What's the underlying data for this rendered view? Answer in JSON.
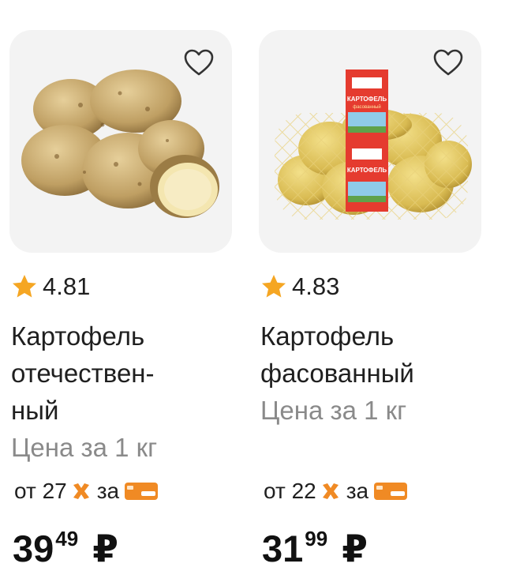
{
  "products": [
    {
      "rating": "4.81",
      "title": "Картофель\nотечествен-\nный",
      "unit_text": "Цена за 1 кг",
      "promo": {
        "from": "от",
        "threshold": "27",
        "za": "за"
      },
      "price": {
        "rub": "39",
        "kop": "49",
        "currency": "₽"
      },
      "icons": {
        "favorite": "heart-outline-icon",
        "rating": "star-icon",
        "promo": "x-mark-icon",
        "payment": "mir-card-icon"
      }
    },
    {
      "rating": "4.83",
      "title": "Картофель\nфасованный",
      "unit_text": "Цена за 1 кг",
      "promo": {
        "from": "от",
        "threshold": "22",
        "za": "за"
      },
      "price": {
        "rub": "31",
        "kop": "99",
        "currency": "₽"
      },
      "package_labels": {
        "line1": "КАРТОФЕЛЬ",
        "line2": "фасованный"
      },
      "icons": {
        "favorite": "heart-outline-icon",
        "rating": "star-icon",
        "promo": "x-mark-icon",
        "payment": "mir-card-icon"
      }
    }
  ],
  "colors": {
    "accent": "#f08a24",
    "star": "#f5a623",
    "muted": "#8a8a8a",
    "card_bg": "#f3f3f3"
  }
}
